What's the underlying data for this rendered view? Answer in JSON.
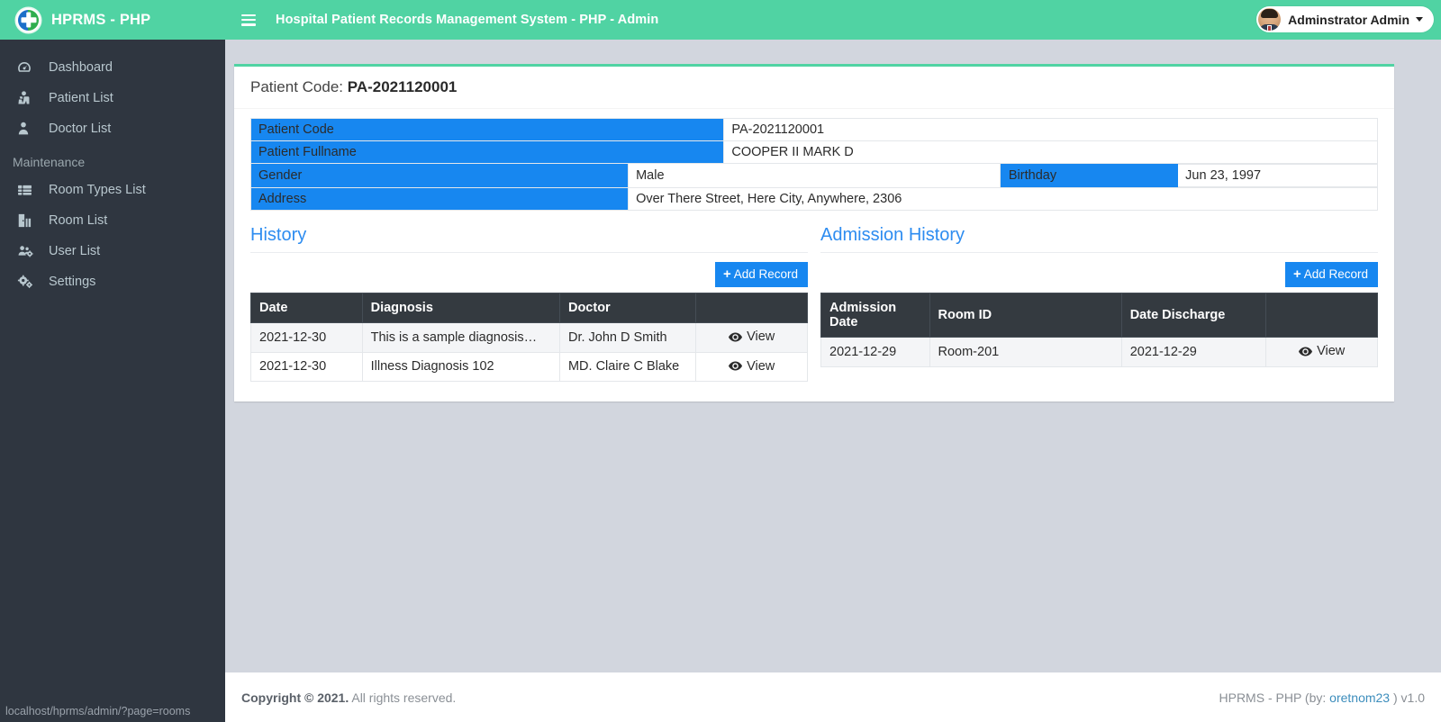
{
  "brand": {
    "name": "HPRMS - PHP",
    "logo_icon": "hospital-cross-logo-icon",
    "green": "#50d3a3",
    "blue": "#1787f0",
    "dark": "#2f3640"
  },
  "sidebar": {
    "items": [
      {
        "label": "Dashboard",
        "icon": "tachometer-icon",
        "name": "sidebar-item-dashboard"
      },
      {
        "label": "Patient List",
        "icon": "user-injured-icon",
        "name": "sidebar-item-patient-list"
      },
      {
        "label": "Doctor List",
        "icon": "user-md-icon",
        "name": "sidebar-item-doctor-list"
      }
    ],
    "section_header": "Maintenance",
    "maintenance_items": [
      {
        "label": "Room Types List",
        "icon": "table-list-icon",
        "name": "sidebar-item-room-types-list"
      },
      {
        "label": "Room List",
        "icon": "door-open-icon",
        "name": "sidebar-item-room-list"
      },
      {
        "label": "User List",
        "icon": "users-cog-icon",
        "name": "sidebar-item-user-list"
      },
      {
        "label": "Settings",
        "icon": "cogs-icon",
        "name": "sidebar-item-settings"
      }
    ]
  },
  "statusbar": {
    "url": "localhost/hprms/admin/?page=rooms"
  },
  "topbar": {
    "menu_icon": "hamburger-icon",
    "title": "Hospital Patient Records Management System - PHP - Admin",
    "user": {
      "name": "Adminstrator Admin",
      "avatar_icon": "user-avatar",
      "caret_icon": "caret-down-icon"
    }
  },
  "page": {
    "header_label": "Patient Code:",
    "header_value": "PA-2021120001"
  },
  "details": {
    "rows": [
      {
        "label": "Patient Code",
        "value": "PA-2021120001"
      },
      {
        "label": "Patient Fullname",
        "value": "COOPER II MARK D"
      }
    ],
    "gender_label": "Gender",
    "gender_value": "Male",
    "birthday_label": "Birthday",
    "birthday_value": "Jun 23, 1997",
    "address_label": "Address",
    "address_value": "Over There Street, Here City, Anywhere, 2306"
  },
  "history": {
    "title": "History",
    "add_button": "Add Record",
    "add_icon": "plus-icon",
    "columns": [
      "Date",
      "Diagnosis",
      "Doctor",
      ""
    ],
    "rows": [
      {
        "date": "2021-12-30",
        "diagnosis": "This is a sample diagnosis…",
        "doctor": "Dr. John D Smith",
        "action": "View"
      },
      {
        "date": "2021-12-30",
        "diagnosis": "Illness Diagnosis 102",
        "doctor": "MD. Claire C Blake",
        "action": "View"
      }
    ]
  },
  "admission": {
    "title": "Admission History",
    "add_button": "Add Record",
    "add_icon": "plus-icon",
    "columns": [
      "Admission Date",
      "Room ID",
      "Date Discharge",
      ""
    ],
    "rows": [
      {
        "date": "2021-12-29",
        "room": "Room-201",
        "discharge": "2021-12-29",
        "action": "View"
      }
    ]
  },
  "footer": {
    "copyright_bold": "Copyright © 2021.",
    "copyright_rest": " All rights reserved.",
    "right_prefix": "HPRMS - PHP (by: ",
    "right_link": "oretnom23",
    "right_suffix": " ) v1.0"
  }
}
